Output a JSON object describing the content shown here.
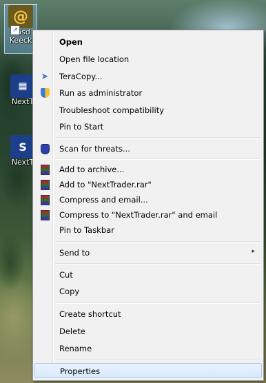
{
  "desktop": {
    "icons": [
      {
        "label": "Nasd",
        "label2": "Keeck",
        "icon": "app-icon"
      },
      {
        "label": "NextT",
        "icon": "app-icon"
      },
      {
        "label": "NextT",
        "icon": "app-icon"
      }
    ]
  },
  "menu": {
    "items": [
      {
        "label": "Open",
        "icon": null,
        "bold": true
      },
      {
        "label": "Open file location",
        "icon": null
      },
      {
        "label": "TeraCopy...",
        "icon": "teracopy-icon"
      },
      {
        "label": "Run as administrator",
        "icon": "shield-icon"
      },
      {
        "label": "Troubleshoot compatibility",
        "icon": null
      },
      {
        "label": "Pin to Start",
        "icon": null
      },
      {
        "label": "Scan for threats...",
        "icon": "antivirus-icon"
      },
      {
        "label": "Add to archive...",
        "icon": "winrar-icon"
      },
      {
        "label": "Add to \"NextTrader.rar\"",
        "icon": "winrar-icon"
      },
      {
        "label": "Compress and email...",
        "icon": "winrar-icon"
      },
      {
        "label": "Compress to \"NextTrader.rar\" and email",
        "icon": "winrar-icon"
      },
      {
        "label": "Pin to Taskbar",
        "icon": null
      },
      {
        "label": "Send to",
        "icon": null,
        "submenu": true
      },
      {
        "label": "Cut",
        "icon": null
      },
      {
        "label": "Copy",
        "icon": null
      },
      {
        "label": "Create shortcut",
        "icon": null
      },
      {
        "label": "Delete",
        "icon": null
      },
      {
        "label": "Rename",
        "icon": null
      },
      {
        "label": "Properties",
        "icon": null,
        "highlighted": true
      }
    ],
    "submenu_arrow": "▸"
  }
}
